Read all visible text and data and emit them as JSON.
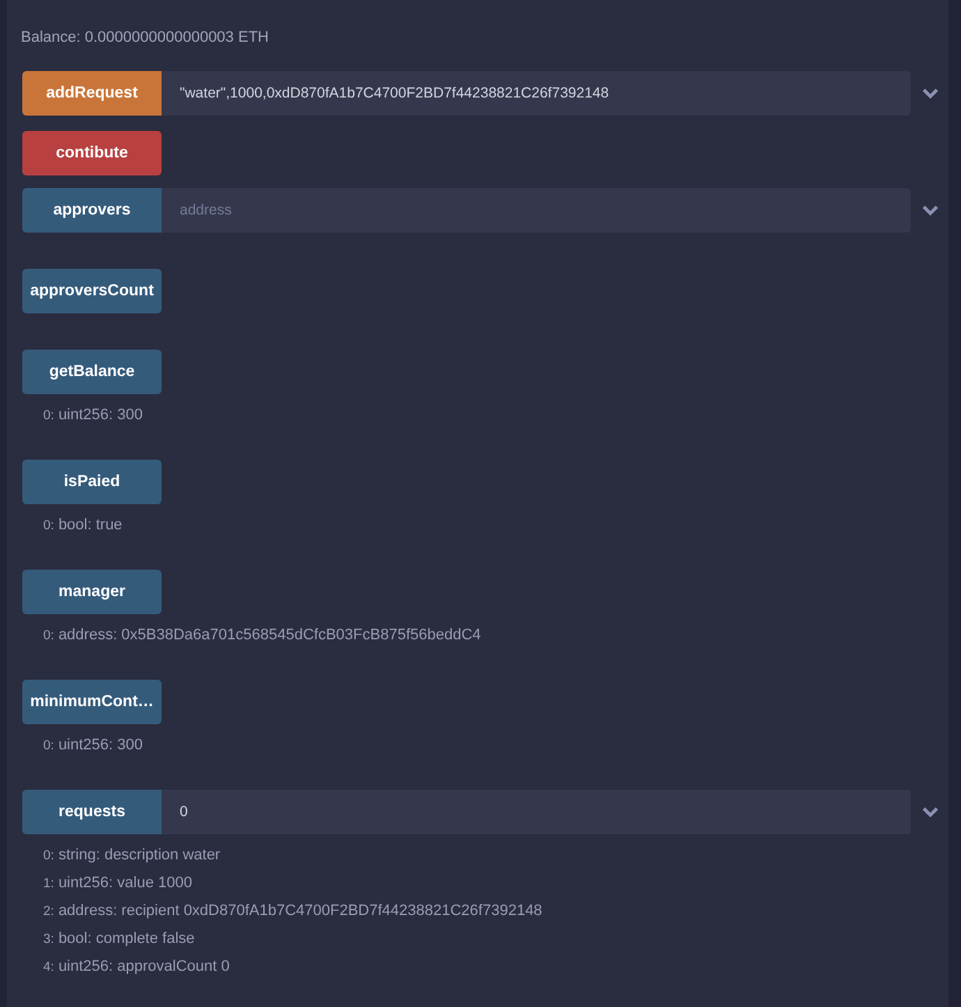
{
  "balance": "Balance: 0.0000000000000003 ETH",
  "functions": [
    {
      "kind": "transact",
      "label": "addRequest",
      "input": {
        "value": "\"water\",1000,0xdD870fA1b7C4700F2BD7f44238821C26f7392148"
      }
    },
    {
      "kind": "payable",
      "label": "contibute"
    },
    {
      "kind": "call",
      "label": "approvers",
      "input": {
        "placeholder": "address"
      }
    },
    {
      "kind": "call",
      "label": "approversCount"
    },
    {
      "kind": "call",
      "label": "getBalance",
      "outputs": [
        {
          "index": "0:",
          "value": "uint256: 300"
        }
      ]
    },
    {
      "kind": "call",
      "label": "isPaied",
      "outputs": [
        {
          "index": "0:",
          "value": "bool: true"
        }
      ]
    },
    {
      "kind": "call",
      "label": "manager",
      "outputs": [
        {
          "index": "0:",
          "value": "address: 0x5B38Da6a701c568545dCfcB03FcB875f56beddC4"
        }
      ]
    },
    {
      "kind": "call",
      "label": "minimumCont…",
      "outputs": [
        {
          "index": "0:",
          "value": "uint256: 300"
        }
      ]
    },
    {
      "kind": "call",
      "label": "requests",
      "input": {
        "value": "0"
      },
      "outputs": [
        {
          "index": "0:",
          "value": "string: description water"
        },
        {
          "index": "1:",
          "value": "uint256: value 1000"
        },
        {
          "index": "2:",
          "value": "address: recipient 0xdD870fA1b7C4700F2BD7f44238821C26f7392148"
        },
        {
          "index": "3:",
          "value": "bool: complete false"
        },
        {
          "index": "4:",
          "value": "uint256: approvalCount 0"
        }
      ]
    }
  ]
}
